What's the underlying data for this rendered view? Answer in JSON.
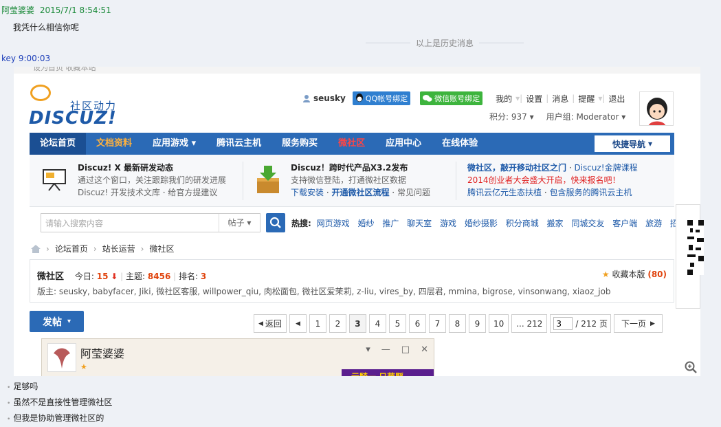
{
  "chat": {
    "sender1": "阿莹婆婆",
    "time1": "2015/7/1 8:54:51",
    "msg1": "我凭什么相信你呢",
    "history_label": "以上是历史消息",
    "sender2": "key",
    "time2": "9:00:03",
    "bottom_msgs": [
      "足够吗",
      "虽然不是直接性管理微社区",
      "但我是协助管理微社区的"
    ]
  },
  "site": {
    "topbar": "设为首页  收藏本站",
    "logo_tag": "社区动力",
    "logo_word": "DISCUZ!",
    "user": {
      "username": "seusky",
      "qq_bind": "QQ帐号绑定",
      "wx_bind": "微信账号绑定",
      "links": [
        "我的",
        "设置",
        "消息",
        "提醒",
        "退出"
      ],
      "points": "积分: 937",
      "group": "用户组: Moderator"
    },
    "nav": {
      "items": [
        "论坛首页",
        "文档资料",
        "应用游戏",
        "腾讯云主机",
        "服务购买",
        "微社区",
        "应用中心",
        "在线体验"
      ],
      "quick": "快捷导航"
    },
    "news": {
      "col1": {
        "title": "Discuz! X 最新研发动态",
        "line1": "通过这个窗口，关注跟踪我们的研发进展",
        "line2a": "Discuz! 开发技术文库",
        "line2b": "给官方提建议"
      },
      "col2": {
        "title": "Discuz！跨时代产品X3.2发布",
        "line1": "支持微信登陆，打通微社区数据",
        "line2a": "下载安装",
        "line2b": "开通微社区流程",
        "line2c": "常见问题"
      },
      "col3": {
        "line1a": "微社区，敲开移动社区之门",
        "line1b": "Discuz!金牌课程",
        "line2": "2014创业者大会盛大开启，快来报名吧！",
        "line3a": "腾讯云亿元生态扶植",
        "line3b": "包含服务的腾讯云主机"
      }
    },
    "search": {
      "placeholder": "请输入搜索内容",
      "scope": "帖子",
      "hot_label": "热搜:",
      "hot": [
        "网页游戏",
        "婚纱",
        "推广",
        "聊天室",
        "游戏",
        "婚纱摄影",
        "积分商城",
        "搬家",
        "同城交友",
        "客户端",
        "旅游",
        "招聘"
      ]
    },
    "breadcrumb": [
      "论坛首页",
      "站长运营",
      "微社区"
    ],
    "forum": {
      "name": "微社区",
      "today_label": "今日:",
      "today": "15",
      "topics_label": "主题:",
      "topics": "8456",
      "rank_label": "排名:",
      "rank": "3",
      "moderators": "版主: seusky, babyfacer, Jiki, 微社区客服, willpower_qiu, 肉松面包, 微社区爱茉莉, z-liu, vires_by, 四层君, mmina, bigrose, vinsonwang, xiaoz_job",
      "fav_label": "收藏本版",
      "fav_count": "(80)"
    },
    "post_button": "发帖",
    "pager": {
      "prev": "返回",
      "pages": [
        "1",
        "2",
        "3",
        "4",
        "5",
        "6",
        "7",
        "8",
        "9",
        "10",
        "... 212"
      ],
      "current": "3",
      "input": "3",
      "total": "/ 212 页",
      "next": "下一页"
    },
    "popup": {
      "name": "阿莹婆婆",
      "banner": "元騎一 日華縣"
    }
  }
}
